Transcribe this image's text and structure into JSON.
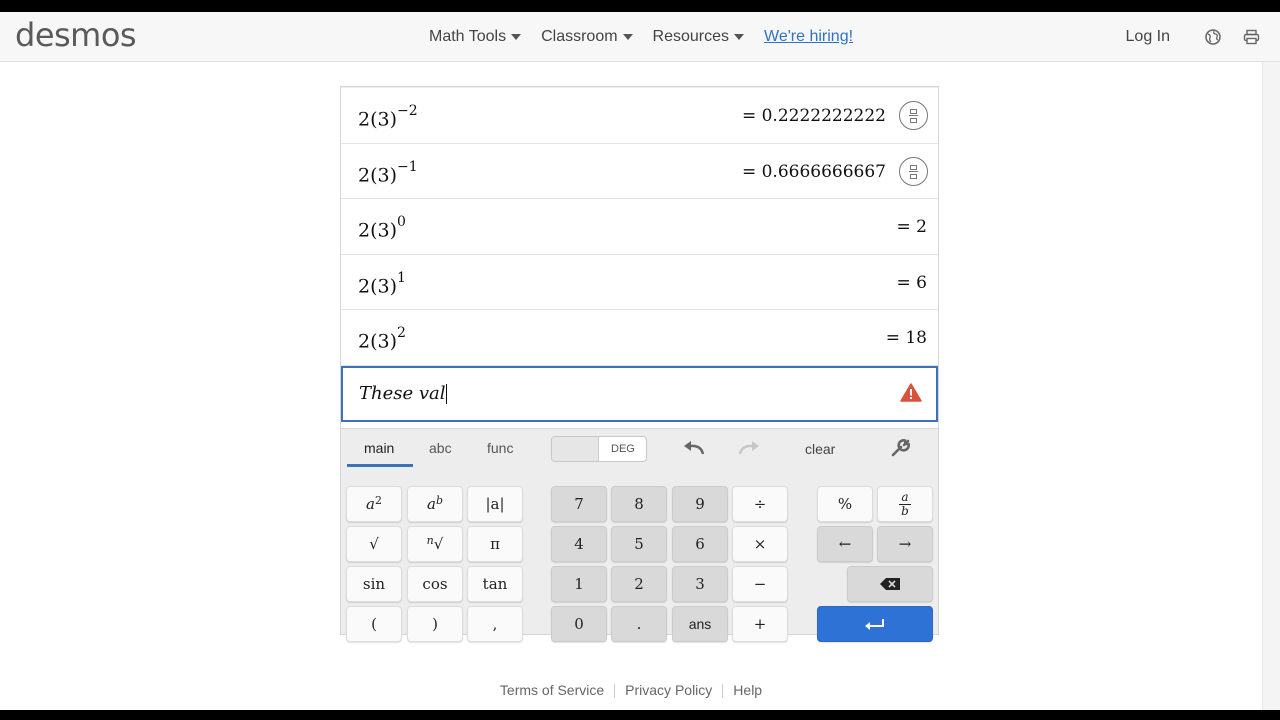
{
  "header": {
    "logo": "desmos",
    "nav": [
      "Math Tools",
      "Classroom",
      "Resources"
    ],
    "hiring": "We're hiring!",
    "login": "Log In",
    "icons": [
      "globe-icon",
      "print-icon"
    ]
  },
  "expressions": [
    {
      "base": "2(3)",
      "exp": "−2",
      "result": "= 0.2222222222",
      "fraction_toggle": true
    },
    {
      "base": "2(3)",
      "exp": "−1",
      "result": "= 0.6666666667",
      "fraction_toggle": true
    },
    {
      "base": "2(3)",
      "exp": "0",
      "result": "= 2",
      "fraction_toggle": false
    },
    {
      "base": "2(3)",
      "exp": "1",
      "result": "= 6",
      "fraction_toggle": false
    },
    {
      "base": "2(3)",
      "exp": "2",
      "result": "= 18",
      "fraction_toggle": false
    }
  ],
  "note": {
    "text": "These val",
    "icon": "warning-icon"
  },
  "keypad": {
    "tabs": [
      "main",
      "abc",
      "func"
    ],
    "active_tab": "main",
    "angle_mode": "DEG",
    "clear": "clear",
    "keys": {
      "abs": "|a|",
      "pi": "π",
      "sin": "sin",
      "cos": "cos",
      "tan": "tan",
      "lparen": "(",
      "rparen": ")",
      "comma": ",",
      "n7": "7",
      "n8": "8",
      "n9": "9",
      "div": "÷",
      "n4": "4",
      "n5": "5",
      "n6": "6",
      "mul": "×",
      "n1": "1",
      "n2": "2",
      "n3": "3",
      "minus": "−",
      "n0": "0",
      "dot": ".",
      "ans": "ans",
      "plus": "+",
      "percent": "%",
      "left": "←",
      "right": "→",
      "square_base": "a",
      "square_exp": "2",
      "power_base": "a",
      "power_exp": "b",
      "frac_num": "a",
      "frac_den": "b",
      "sqrt": "√",
      "nthroot_index": "n",
      "nthroot_symbol": "√"
    }
  },
  "footer": [
    "Terms of Service",
    "Privacy Policy",
    "Help"
  ]
}
